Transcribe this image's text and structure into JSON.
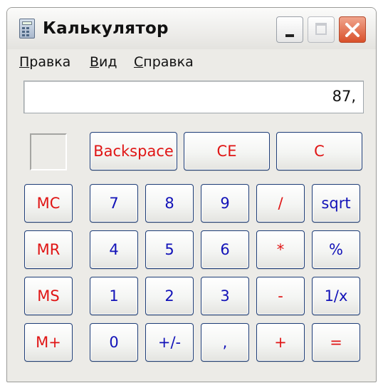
{
  "window": {
    "title": "Калькулятор"
  },
  "menu": {
    "items": [
      "Правка",
      "Вид",
      "Справка"
    ]
  },
  "display": {
    "value": "87,"
  },
  "top_buttons": [
    "Backspace",
    "CE",
    "C"
  ],
  "memory_buttons": [
    "MC",
    "MR",
    "MS",
    "M+"
  ],
  "keypad": [
    [
      "7",
      "8",
      "9",
      "/",
      "sqrt"
    ],
    [
      "4",
      "5",
      "6",
      "*",
      "%"
    ],
    [
      "1",
      "2",
      "3",
      "-",
      "1/x"
    ],
    [
      "0",
      "+/-",
      ",",
      "+",
      "="
    ]
  ],
  "colors": {
    "operator_text": "#e01515",
    "digit_text": "#1212b8",
    "window_bg": "#ecebe7",
    "button_border": "#1f3e78"
  }
}
